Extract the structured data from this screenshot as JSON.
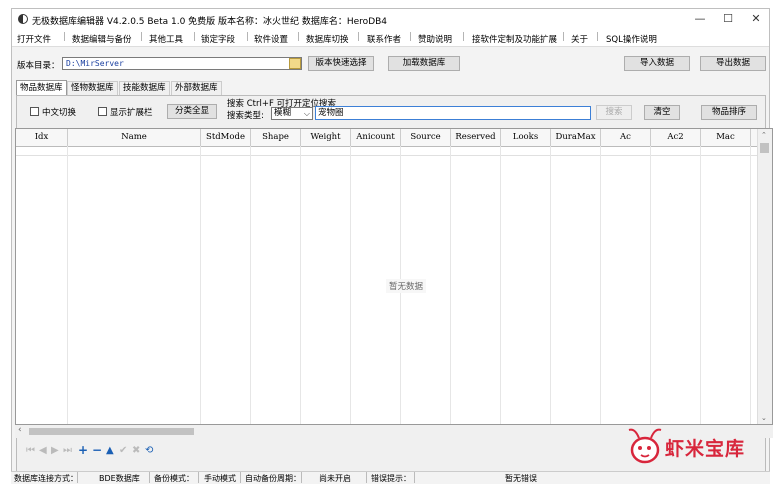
{
  "titlebar": {
    "title": "无极数据库编辑器 V4.2.0.5    Beta 1.0 免费版    版本名称：冰火世纪    数据库名：HeroDB4",
    "minimize": "—",
    "maximize": "☐",
    "close": "✕"
  },
  "menu": [
    "打开文件",
    "数据编辑与备份",
    "其他工具",
    "锁定字段",
    "软件设置",
    "数据库切换",
    "联系作者",
    "赞助说明",
    "接软件定制及功能扩展",
    "关于",
    "SQL操作说明"
  ],
  "toolbar": {
    "dir_label": "版本目录：",
    "dir_value": "D:\\MirServer",
    "quick_select": "版本快速选择",
    "load_db": "加载数据库",
    "import": "导入数据",
    "export": "导出数据"
  },
  "tabs": [
    "物品数据库",
    "怪物数据库",
    "技能数据库",
    "外部数据库"
  ],
  "filters": {
    "chinese_toggle": "中文切换",
    "show_ext": "显示扩展栏",
    "category_all": "分类全显",
    "search_hint": "搜索  Ctrl+F 可打开定位搜索",
    "search_type_label": "搜索类型:",
    "search_type_value": "模糊",
    "search_value": "宠物圈",
    "search_btn": "搜索",
    "clear_btn": "清空",
    "sort_btn": "物品排序"
  },
  "table": {
    "columns": [
      "Idx",
      "Name",
      "StdMode",
      "Shape",
      "Weight",
      "Anicount",
      "Source",
      "Reserved",
      "Looks",
      "DuraMax",
      "Ac",
      "Ac2",
      "Mac"
    ],
    "empty_text": "暂无数据"
  },
  "status": {
    "conn_label": "数据库连接方式：",
    "conn_value": "BDE数据库",
    "backup_mode_label": "备份模式：",
    "backup_mode_value": "手动模式",
    "auto_backup_label": "自动备份周期：",
    "auto_backup_value": "尚未开启",
    "error_label": "错误提示：",
    "error_value": "暂无错误"
  },
  "watermark": "虾米宝库"
}
